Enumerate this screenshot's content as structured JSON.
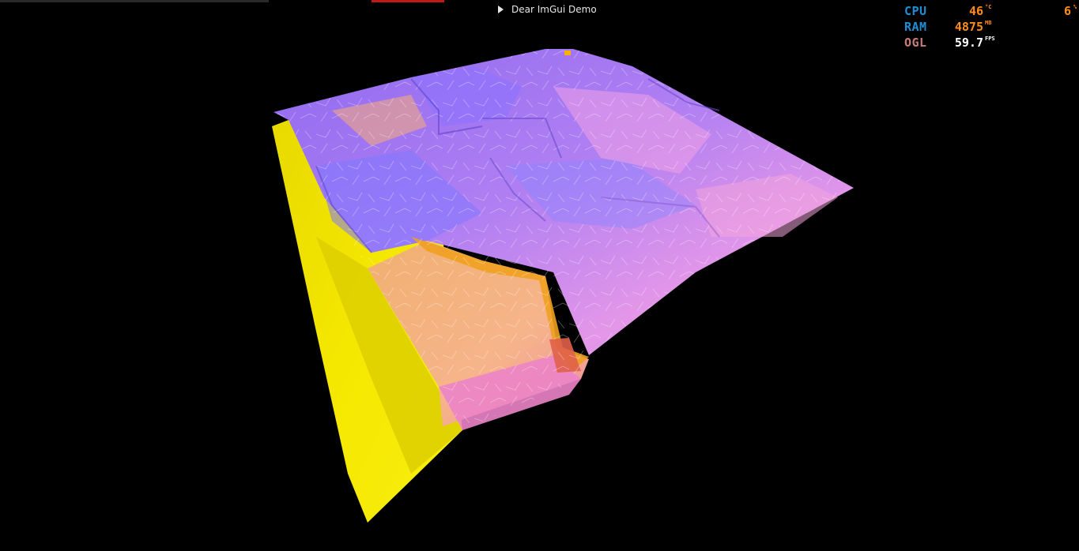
{
  "window": {
    "title": "Dear ImGui Demo"
  },
  "stats": {
    "cpu": {
      "label": "CPU",
      "temp_value": "46",
      "temp_unit": "°C",
      "load_value": "6",
      "load_unit": "%",
      "label_color": "#1e8fd6",
      "value_color": "#ff8c1a"
    },
    "ram": {
      "label": "RAM",
      "value": "4875",
      "unit": "MB",
      "label_color": "#1e8fd6",
      "value_color": "#ff8c1a"
    },
    "ogl": {
      "label": "OGL",
      "value": "59.7",
      "unit": "FPS",
      "label_color": "#c97c78",
      "value_color": "#ffffff"
    }
  },
  "scene": {
    "description_colors": {
      "background": "#000000",
      "terrain_purple": "#9a6cf2",
      "terrain_pink": "#e591e0",
      "terrain_orange": "#f2a86a",
      "terrain_yellow": "#f2e200"
    }
  }
}
